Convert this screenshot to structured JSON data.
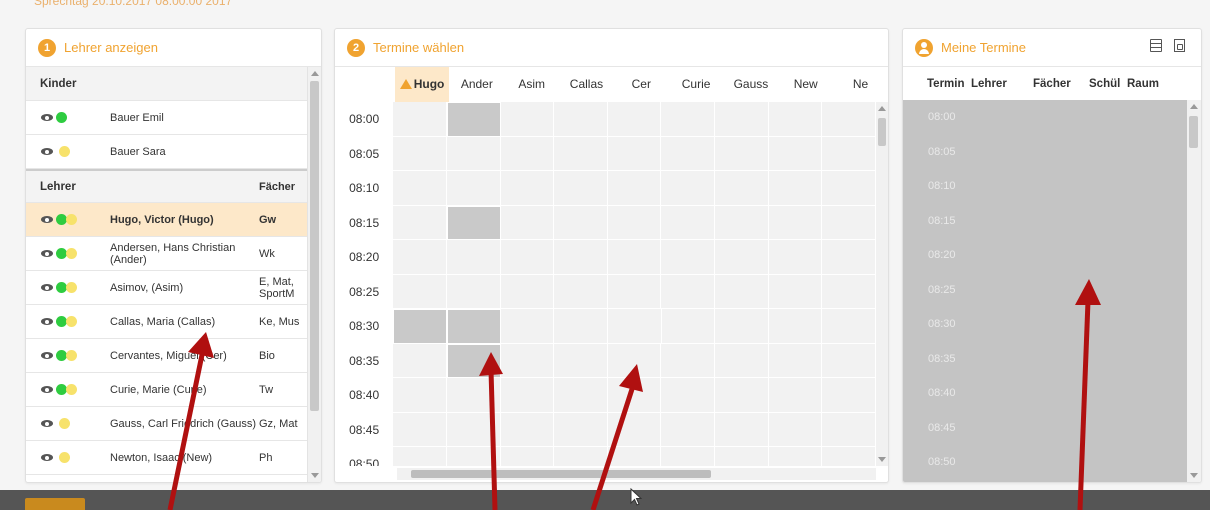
{
  "topline": "Sprechtag 20.10.2017 08:00:00 2017",
  "panel1": {
    "step": "1",
    "title": "Lehrer anzeigen",
    "kinder_header": "Kinder",
    "kinder": [
      {
        "name": "Bauer Emil",
        "dots": [
          "green"
        ]
      },
      {
        "name": "Bauer Sara",
        "dots": [
          "yellow"
        ]
      }
    ],
    "lehrer_header": "Lehrer",
    "faecher_header": "Fächer",
    "lehrer": [
      {
        "name": "Hugo, Victor (Hugo)",
        "faecher": "Gw",
        "dots": [
          "green",
          "yellow"
        ],
        "selected": true
      },
      {
        "name": "Andersen, Hans Christian (Ander)",
        "faecher": "Wk",
        "dots": [
          "green",
          "yellow"
        ]
      },
      {
        "name": "Asimov, (Asim)",
        "faecher": "E, Mat, SportM",
        "dots": [
          "green",
          "yellow"
        ]
      },
      {
        "name": "Callas, Maria (Callas)",
        "faecher": "Ke, Mus",
        "dots": [
          "green",
          "yellow"
        ]
      },
      {
        "name": "Cervantes, Miguel (Cer)",
        "faecher": "Bio",
        "dots": [
          "green",
          "yellow"
        ]
      },
      {
        "name": "Curie, Marie (Curie)",
        "faecher": "Tw",
        "dots": [
          "green",
          "yellow"
        ]
      },
      {
        "name": "Gauss, Carl Friedrich (Gauss)",
        "faecher": "Gz, Mat",
        "dots": [
          "yellow"
        ]
      },
      {
        "name": "Newton, Isaac (New)",
        "faecher": "Ph",
        "dots": [
          "yellow"
        ]
      }
    ]
  },
  "panel2": {
    "step": "2",
    "title": "Termine wählen",
    "columns": [
      "Hugo",
      "Ander",
      "Asim",
      "Callas",
      "Cer",
      "Curie",
      "Gauss",
      "New",
      "Ne"
    ],
    "times": [
      "08:00",
      "08:05",
      "08:10",
      "08:15",
      "08:20",
      "08:25",
      "08:30",
      "08:35",
      "08:40",
      "08:45",
      "08:50"
    ],
    "busy": {
      "08:00": [
        1
      ],
      "08:15": [
        1
      ],
      "08:30": [
        0,
        1
      ],
      "08:35": [
        1
      ]
    }
  },
  "panel3": {
    "title": "Meine Termine",
    "headers": [
      "Termin",
      "Lehrer",
      "Fächer",
      "Schül",
      "Raum"
    ],
    "times": [
      "08:00",
      "08:05",
      "08:10",
      "08:15",
      "08:20",
      "08:25",
      "08:30",
      "08:35",
      "08:40",
      "08:45",
      "08:50"
    ]
  },
  "colors": {
    "accent": "#f0a330",
    "busy": "#c9c9c9",
    "arrow": "#b01010"
  }
}
